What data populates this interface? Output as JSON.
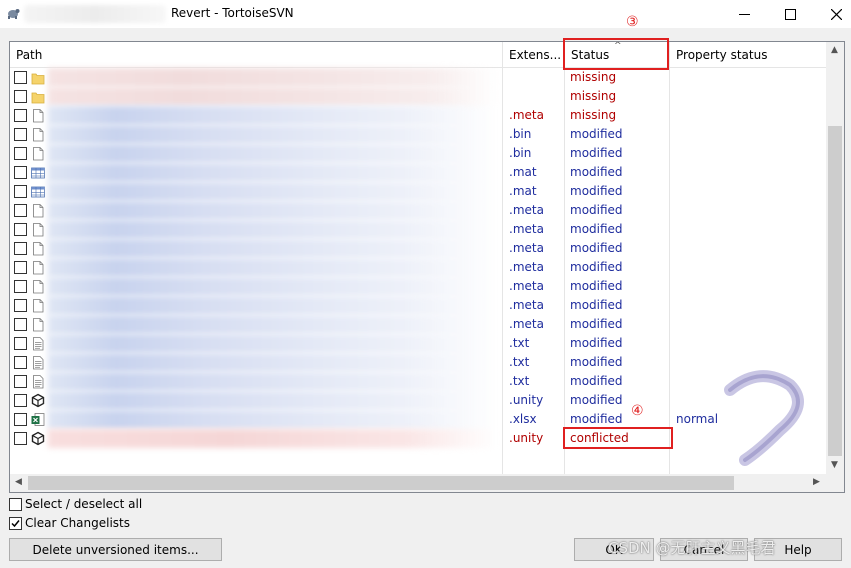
{
  "window": {
    "title": "Revert - TortoiseSVN",
    "minimize_icon": "minimize-icon",
    "maximize_icon": "maximize-icon",
    "close_icon": "close-icon"
  },
  "columns": {
    "path": "Path",
    "extension": "Extens...",
    "status": "Status",
    "property_status": "Property status",
    "sort_indicator": "^"
  },
  "rows": [
    {
      "icon": "folder-icon",
      "ext": "",
      "status": "missing",
      "status_color": "#b00000",
      "prop": ""
    },
    {
      "icon": "folder-icon",
      "ext": "",
      "status": "missing",
      "status_color": "#b00000",
      "prop": ""
    },
    {
      "icon": "file-icon",
      "ext": ".meta",
      "status": "missing",
      "status_color": "#b00000",
      "prop": ""
    },
    {
      "icon": "file-icon",
      "ext": ".bin",
      "status": "modified",
      "status_color": "#1f2d9e",
      "prop": ""
    },
    {
      "icon": "file-icon",
      "ext": ".bin",
      "status": "modified",
      "status_color": "#1f2d9e",
      "prop": ""
    },
    {
      "icon": "table-icon",
      "ext": ".mat",
      "status": "modified",
      "status_color": "#1f2d9e",
      "prop": ""
    },
    {
      "icon": "table-icon",
      "ext": ".mat",
      "status": "modified",
      "status_color": "#1f2d9e",
      "prop": ""
    },
    {
      "icon": "file-icon",
      "ext": ".meta",
      "status": "modified",
      "status_color": "#1f2d9e",
      "prop": ""
    },
    {
      "icon": "file-icon",
      "ext": ".meta",
      "status": "modified",
      "status_color": "#1f2d9e",
      "prop": ""
    },
    {
      "icon": "file-icon",
      "ext": ".meta",
      "status": "modified",
      "status_color": "#1f2d9e",
      "prop": ""
    },
    {
      "icon": "file-icon",
      "ext": ".meta",
      "status": "modified",
      "status_color": "#1f2d9e",
      "prop": ""
    },
    {
      "icon": "file-icon",
      "ext": ".meta",
      "status": "modified",
      "status_color": "#1f2d9e",
      "prop": ""
    },
    {
      "icon": "file-icon",
      "ext": ".meta",
      "status": "modified",
      "status_color": "#1f2d9e",
      "prop": ""
    },
    {
      "icon": "file-icon",
      "ext": ".meta",
      "status": "modified",
      "status_color": "#1f2d9e",
      "prop": ""
    },
    {
      "icon": "text-file-icon",
      "ext": ".txt",
      "status": "modified",
      "status_color": "#1f2d9e",
      "prop": ""
    },
    {
      "icon": "text-file-icon",
      "ext": ".txt",
      "status": "modified",
      "status_color": "#1f2d9e",
      "prop": ""
    },
    {
      "icon": "text-file-icon",
      "ext": ".txt",
      "status": "modified",
      "status_color": "#1f2d9e",
      "prop": ""
    },
    {
      "icon": "unity-icon",
      "ext": ".unity",
      "status": "modified",
      "status_color": "#1f2d9e",
      "prop": ""
    },
    {
      "icon": "excel-icon",
      "ext": ".xlsx",
      "status": "modified",
      "status_color": "#1f2d9e",
      "prop": "normal"
    },
    {
      "icon": "unity-icon",
      "ext": ".unity",
      "status": "conflicted",
      "status_color": "#b00000",
      "prop": ""
    }
  ],
  "annotations": {
    "status_marker": "③",
    "conflict_marker": "④"
  },
  "footer": {
    "select_all_label": "Select / deselect all",
    "clear_changelists_label": "Clear Changelists",
    "delete_unversioned_label": "Delete unversioned items...",
    "ok_label": "OK",
    "cancel_label": "Cancel",
    "help_label": "Help",
    "watermark": "CSDN @无肝主义黑毛君"
  }
}
